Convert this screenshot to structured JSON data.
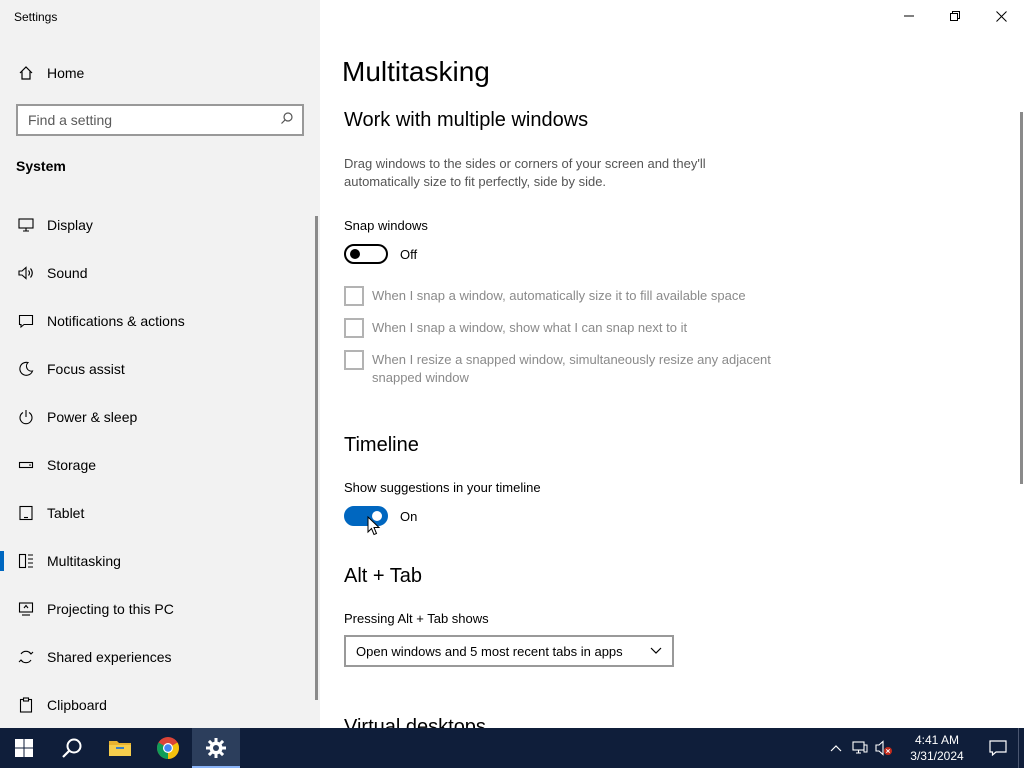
{
  "window": {
    "title": "Settings"
  },
  "sidebar": {
    "home_label": "Home",
    "search_placeholder": "Find a setting",
    "section_title": "System",
    "items": [
      {
        "label": "Display",
        "icon": "display-icon"
      },
      {
        "label": "Sound",
        "icon": "sound-icon"
      },
      {
        "label": "Notifications & actions",
        "icon": "notifications-icon"
      },
      {
        "label": "Focus assist",
        "icon": "focus-assist-icon"
      },
      {
        "label": "Power & sleep",
        "icon": "power-icon"
      },
      {
        "label": "Storage",
        "icon": "storage-icon"
      },
      {
        "label": "Tablet",
        "icon": "tablet-icon"
      },
      {
        "label": "Multitasking",
        "icon": "multitasking-icon",
        "selected": true
      },
      {
        "label": "Projecting to this PC",
        "icon": "projecting-icon"
      },
      {
        "label": "Shared experiences",
        "icon": "shared-experiences-icon"
      },
      {
        "label": "Clipboard",
        "icon": "clipboard-icon"
      }
    ]
  },
  "main": {
    "page_title": "Multitasking",
    "multiple_windows": {
      "heading": "Work with multiple windows",
      "description": "Drag windows to the sides or corners of your screen and they'll automatically size to fit perfectly, side by side.",
      "snap_label": "Snap windows",
      "snap_state": "Off",
      "snap_on": false,
      "options": [
        {
          "label": "When I snap a window, automatically size it to fill available space",
          "checked": false
        },
        {
          "label": "When I snap a window, show what I can snap next to it",
          "checked": false
        },
        {
          "label": "When I resize a snapped window, simultaneously resize any adjacent snapped window",
          "checked": false
        }
      ]
    },
    "timeline": {
      "heading": "Timeline",
      "suggestions_label": "Show suggestions in your timeline",
      "suggestions_state": "On",
      "suggestions_on": true
    },
    "alt_tab": {
      "heading": "Alt + Tab",
      "label": "Pressing Alt + Tab shows",
      "selected_value": "Open windows and 5 most recent tabs in apps"
    },
    "next_heading": "Virtual desktops"
  },
  "taskbar": {
    "apps": [
      "start-icon",
      "search-icon",
      "file-explorer-icon",
      "chrome-icon",
      "settings-icon"
    ],
    "time": "4:41 AM",
    "date": "3/31/2024"
  },
  "colors": {
    "accent": "#0067c0",
    "sidebar_bg": "#f2f2f2",
    "taskbar_bg": "#0f1e3a"
  }
}
